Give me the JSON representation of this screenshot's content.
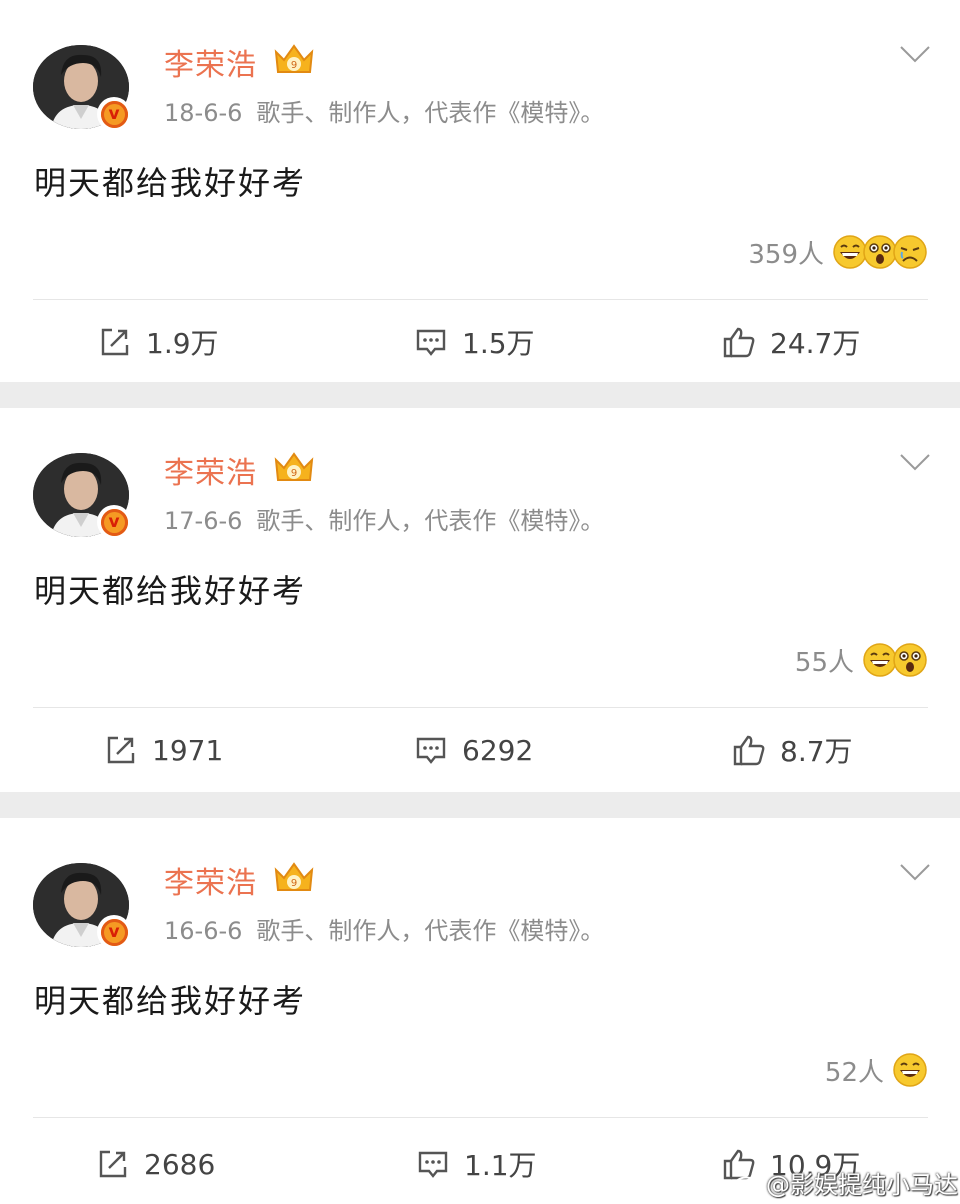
{
  "posts": [
    {
      "author": "李荣浩",
      "date": "18-6-6",
      "bio": "歌手、制作人，代表作《模特》。",
      "text": "明天都给我好好考",
      "reaction_count": "359人",
      "reaction_emojis": [
        "laugh-emoji",
        "surprised-emoji",
        "sad-emoji"
      ],
      "reposts": "1.9万",
      "comments": "1.5万",
      "likes": "24.7万"
    },
    {
      "author": "李荣浩",
      "date": "17-6-6",
      "bio": "歌手、制作人，代表作《模特》。",
      "text": "明天都给我好好考",
      "reaction_count": "55人",
      "reaction_emojis": [
        "laugh-emoji",
        "surprised-emoji"
      ],
      "reposts": "1971",
      "comments": "6292",
      "likes": "8.7万"
    },
    {
      "author": "李荣浩",
      "date": "16-6-6",
      "bio": "歌手、制作人，代表作《模特》。",
      "text": "明天都给我好好考",
      "reaction_count": "52人",
      "reaction_emojis": [
        "laugh-emoji"
      ],
      "reposts": "2686",
      "comments": "1.1万",
      "likes": "10.9万"
    }
  ],
  "watermark": "@影娱提纯小马达",
  "colors": {
    "author_name": "#eb7350",
    "meta_text": "#8c8c8c",
    "separator": "#ececec",
    "emoji_yellow": "#f7c92e",
    "verified_badge": "#f59a23"
  }
}
